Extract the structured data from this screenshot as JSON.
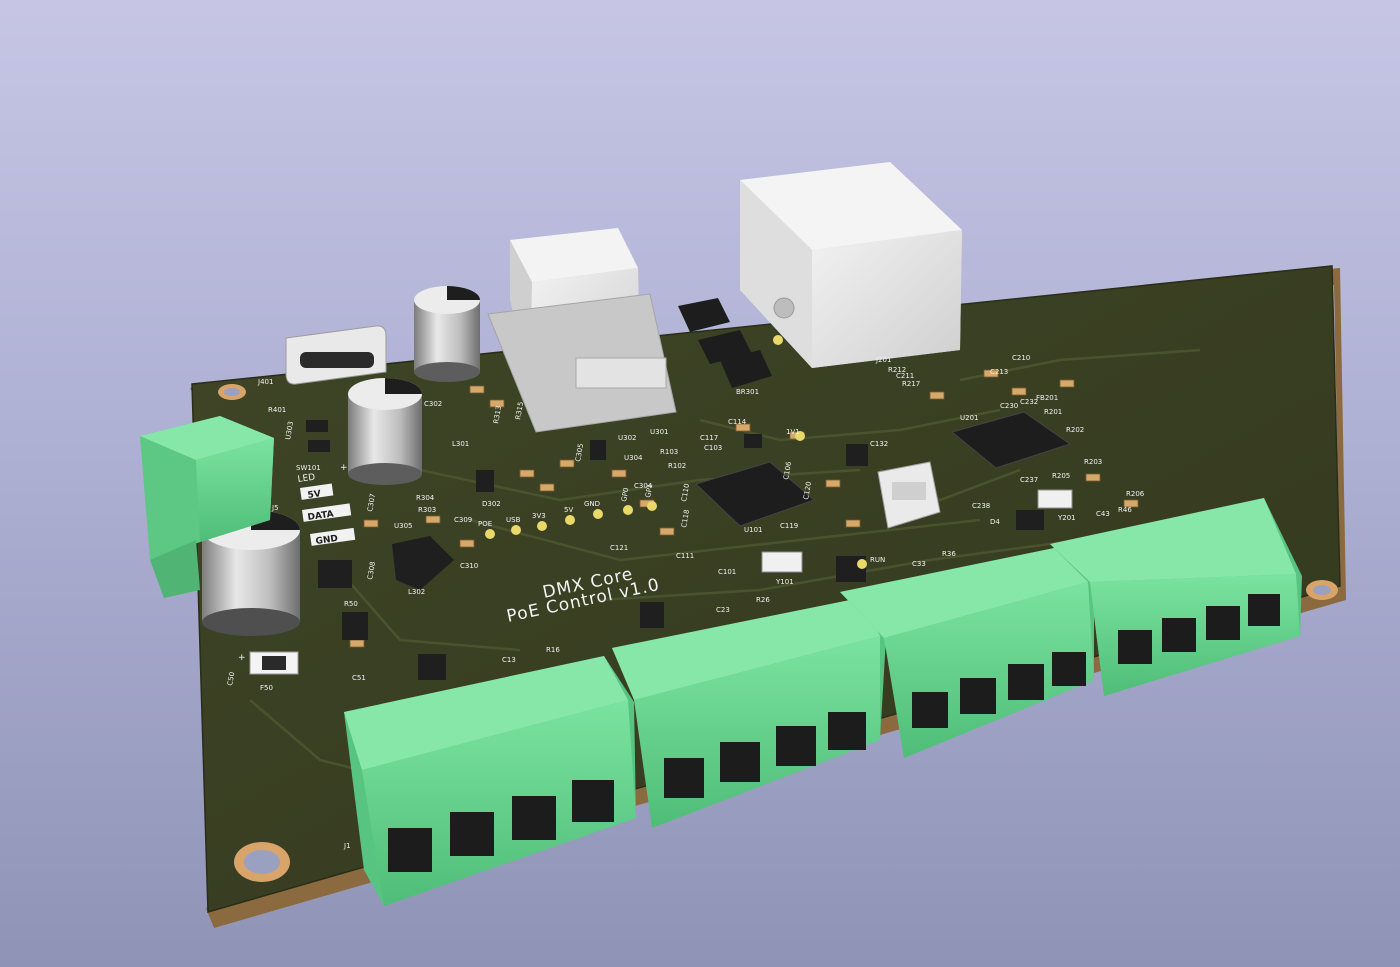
{
  "board": {
    "title_line1": "DMX Core",
    "title_line2": "PoE Control v1.0",
    "colors": {
      "background_top": "#c6c6e4",
      "pcb": "#3a3f22",
      "pcb_edge": "#8a6a3e",
      "terminal": "#6ad68f",
      "jack": "#e6e6e6",
      "pad": "#e9d86a"
    }
  },
  "power_labels": {
    "led": "LED",
    "v5": "5V",
    "data": "DATA",
    "gnd": "GND",
    "plus": "+"
  },
  "test_points": [
    "POE",
    "USB",
    "3V3",
    "5V",
    "GND",
    "GP0",
    "GP1"
  ],
  "extra_pads": [
    "RUN",
    "1V1"
  ],
  "refdes": {
    "j401": "J401",
    "r401": "R401",
    "u303": "U303",
    "sw101": "SW101",
    "j5": "J5",
    "c302": "C302",
    "r313": "R313",
    "r315": "R315",
    "l301": "L301",
    "u302": "U302",
    "u301": "U301",
    "c307": "C307",
    "r304": "R304",
    "r303": "R303",
    "d302": "D302",
    "c309": "C309",
    "u305": "U305",
    "c308": "C308",
    "l302": "L302",
    "c310": "C310",
    "c305": "C305",
    "u304": "U304",
    "r103": "R103",
    "r102": "R102",
    "c304": "C304",
    "c117": "C117",
    "c103": "C103",
    "c114": "C114",
    "c110": "C110",
    "c118": "C118",
    "c121": "C121",
    "c111": "C111",
    "u101": "U101",
    "c119": "C119",
    "c101": "C101",
    "y101": "Y101",
    "c106": "C106",
    "c120": "C120",
    "c132": "C132",
    "br301": "BR301",
    "j201": "J201",
    "r212": "R212",
    "r217": "R217",
    "c211": "C211",
    "c213": "C213",
    "c210": "C210",
    "r201": "R201",
    "r202": "R202",
    "u201": "U201",
    "fb201": "FB201",
    "c230": "C230",
    "c232": "C232",
    "r203": "R203",
    "c237": "C237",
    "r205": "R205",
    "c238": "C238",
    "y201": "Y201",
    "r206": "R206",
    "d4": "D4",
    "c43": "C43",
    "r46": "R46",
    "c33": "C33",
    "r36": "R36",
    "c23": "C23",
    "r26": "R26",
    "c13": "C13",
    "r16": "R16",
    "r50": "R50",
    "c50": "C50",
    "f50": "F50",
    "c51": "C51",
    "j1": "J1"
  }
}
